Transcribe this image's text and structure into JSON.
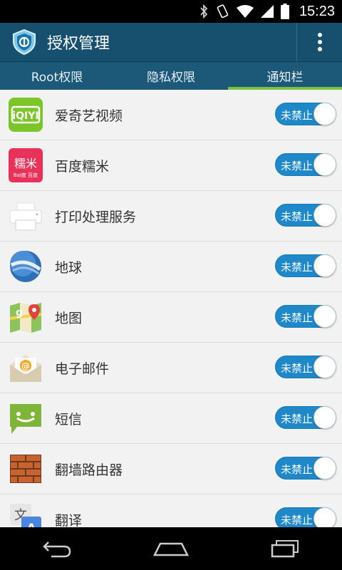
{
  "status_bar": {
    "time": "15:23",
    "icons": [
      "bluetooth-icon",
      "vibrate-icon",
      "wifi-icon",
      "signal-icon",
      "battery-icon"
    ]
  },
  "app_bar": {
    "title": "授权管理",
    "logo_icon": "shield-logo-icon",
    "menu_icon": "overflow-menu-icon",
    "color": "#17506f"
  },
  "tabs": [
    {
      "label": "Root权限",
      "active": false
    },
    {
      "label": "隐私权限",
      "active": false
    },
    {
      "label": "通知栏",
      "active": true
    }
  ],
  "colors": {
    "tab_indicator": "#7dc142",
    "toggle_on": "#1e88c9"
  },
  "apps": [
    {
      "name": "爱奇艺视频",
      "icon": "iqiyi-icon",
      "icon_text": "iQIYI",
      "toggle_label": "未禁止"
    },
    {
      "name": "百度糯米",
      "icon": "baidu-nuomi-icon",
      "icon_text": "糯米",
      "icon_subtext": "Bai度 百度",
      "toggle_label": "未禁止"
    },
    {
      "name": "打印处理服务",
      "icon": "printer-icon",
      "toggle_label": "未禁止"
    },
    {
      "name": "地球",
      "icon": "google-earth-icon",
      "toggle_label": "未禁止"
    },
    {
      "name": "地图",
      "icon": "maps-icon",
      "toggle_label": "未禁止"
    },
    {
      "name": "电子邮件",
      "icon": "email-icon",
      "toggle_label": "未禁止"
    },
    {
      "name": "短信",
      "icon": "sms-icon",
      "toggle_label": "未禁止"
    },
    {
      "name": "翻墙路由器",
      "icon": "brick-wall-icon",
      "toggle_label": "未禁止"
    },
    {
      "name": "翻译",
      "icon": "translate-icon",
      "icon_text": "文",
      "toggle_label": "未禁止"
    }
  ],
  "nav_bar": {
    "buttons": [
      "back-icon",
      "home-icon",
      "recents-icon"
    ]
  }
}
